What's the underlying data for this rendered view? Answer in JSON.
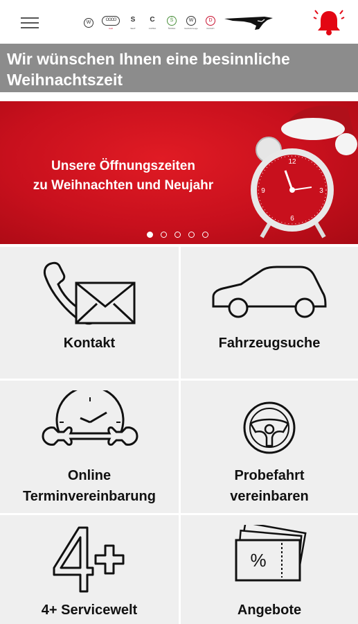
{
  "header": {
    "menu_icon": "hamburger-menu-icon",
    "brands": [
      {
        "name": "vw-logo",
        "mark": "W",
        "caption": ""
      },
      {
        "name": "audi-logo",
        "mark": "OOOO",
        "caption": "Audi"
      },
      {
        "name": "seat-logo",
        "mark": "S",
        "caption": "SEAT"
      },
      {
        "name": "cupra-logo",
        "mark": "C",
        "caption": "CUPRA"
      },
      {
        "name": "skoda-logo",
        "mark": "Š",
        "caption": "ŠKODA"
      },
      {
        "name": "vw-nutzfahrzeuge-logo",
        "mark": "W",
        "caption": "Nutzfahrzeuge"
      },
      {
        "name": "ducati-logo",
        "mark": "D",
        "caption": "DUCATI"
      }
    ],
    "dealer_logo_icon": "leaping-cat-logo-icon",
    "notification_icon": "bell-icon",
    "accent_color": "#e30613"
  },
  "headline": {
    "line1": "Wir wünschen Ihnen eine besinnliche",
    "line2": "Weihnachtszeit"
  },
  "banner": {
    "line1": "Unsere Öffnungszeiten",
    "line2": "zu Weihnachten und Neujahr",
    "image_icon": "alarm-clock-santa-hat-icon",
    "slide_count": 5,
    "active_slide": 1
  },
  "tiles": [
    {
      "line1": "Kontakt",
      "line2": "",
      "icon": "phone-envelope-icon"
    },
    {
      "line1": "Fahrzeugsuche",
      "line2": "",
      "icon": "car-icon"
    },
    {
      "line1": "Online",
      "line2": "Terminvereinbarung",
      "icon": "clock-wrench-icon"
    },
    {
      "line1": "Probefahrt",
      "line2": "vereinbaren",
      "icon": "steering-wheel-icon"
    },
    {
      "line1": "4+ Servicewelt",
      "line2": "",
      "icon": "four-plus-icon"
    },
    {
      "line1": "Angebote",
      "line2": "",
      "icon": "percent-ticket-icon"
    }
  ]
}
